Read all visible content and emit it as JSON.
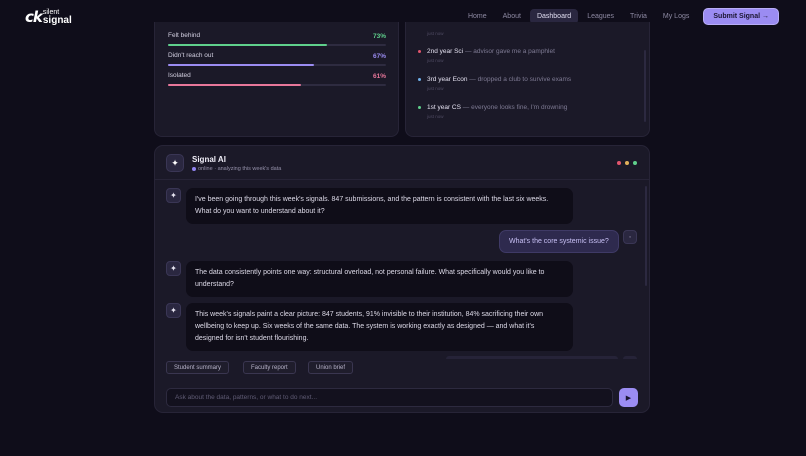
{
  "nav": {
    "logo_mark": "ck",
    "logo_small": "silent",
    "logo_big": "signal",
    "links": [
      "Home",
      "About",
      "Dashboard",
      "Leagues",
      "Trivia",
      "My Logs"
    ],
    "active": "Dashboard",
    "submit_label": "Submit Signal →"
  },
  "stats": [
    {
      "label": "Felt behind",
      "value": "73%",
      "fraction": 0.73,
      "color": "#5fd08c"
    },
    {
      "label": "Didn't reach out",
      "value": "67%",
      "fraction": 0.67,
      "color": "#9b8cf2"
    },
    {
      "label": "Isolated",
      "value": "61%",
      "fraction": 0.61,
      "color": "#e8779a"
    }
  ],
  "feed": {
    "items": [
      {
        "who": "2nd year Sci",
        "msg": "— advisor gave me a pamphlet",
        "time": "just now",
        "color": "#e2556d"
      },
      {
        "who": "3rd year Econ",
        "msg": "— dropped a club to survive exams",
        "time": "just now",
        "color": "#6fb0ea"
      },
      {
        "who": "1st year CS",
        "msg": "— everyone looks fine, I'm drowning",
        "time": "just now",
        "color": "#5fd08c"
      }
    ],
    "top_time": "just now"
  },
  "chat": {
    "title": "Signal AI",
    "status": "online · analyzing this week's data",
    "header_dot_colors": [
      "#e2556d",
      "#e0b05a",
      "#5fd08c"
    ],
    "ai_icon": "sparkle-icon",
    "messages": [
      {
        "role": "ai",
        "text": "I've been going through this week's signals. 847 submissions, and the pattern is consistent with the last six weeks. What do you want to understand about it?"
      },
      {
        "role": "user",
        "text": "What's the core systemic issue?"
      },
      {
        "role": "ai",
        "text": "The data consistently points one way: structural overload, not personal failure. What specifically would you like to understand?"
      },
      {
        "role": "ai",
        "text": "This week's signals paint a clear picture: 847 students, 91% invisible to their institution, 84% sacrificing their own wellbeing to keep up. Six weeks of the same data. The system is working exactly as designed — and what it's designed for isn't student flourishing."
      }
    ],
    "chips": [
      "Student summary",
      "Faculty report",
      "Union brief"
    ],
    "input_placeholder": "Ask about the data, patterns, or what to do next...",
    "send_icon": "send-icon"
  }
}
